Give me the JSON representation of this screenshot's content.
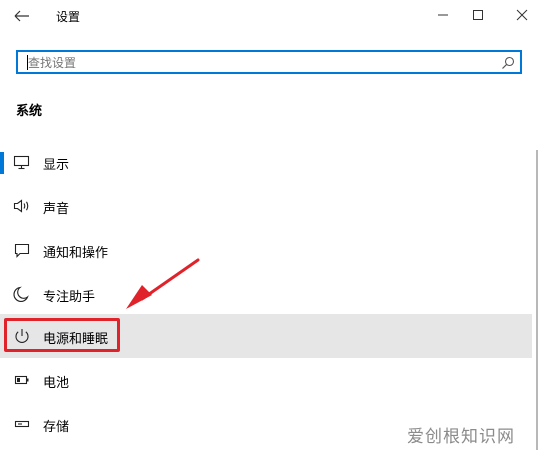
{
  "window": {
    "title": "设置",
    "back_icon": "back-arrow-icon",
    "controls": [
      "minimize-icon",
      "maximize-icon",
      "close-icon"
    ]
  },
  "search": {
    "placeholder": "查找设置",
    "value": "",
    "icon": "search-icon",
    "accent_color": "#0078d7"
  },
  "section": {
    "title": "系统"
  },
  "nav": {
    "items": [
      {
        "label": "显示",
        "icon": "monitor-icon",
        "selected": false,
        "indicator": true
      },
      {
        "label": "声音",
        "icon": "speaker-icon",
        "selected": false
      },
      {
        "label": "通知和操作",
        "icon": "notification-icon",
        "selected": false
      },
      {
        "label": "专注助手",
        "icon": "moon-icon",
        "selected": false
      },
      {
        "label": "电源和睡眠",
        "icon": "power-icon",
        "selected": true,
        "highlighted": true
      },
      {
        "label": "电池",
        "icon": "battery-icon",
        "selected": false
      },
      {
        "label": "存储",
        "icon": "storage-icon",
        "selected": false
      }
    ]
  },
  "annotation": {
    "highlight_color": "#e0232b"
  },
  "watermark": {
    "text": "爱创根知识网"
  }
}
